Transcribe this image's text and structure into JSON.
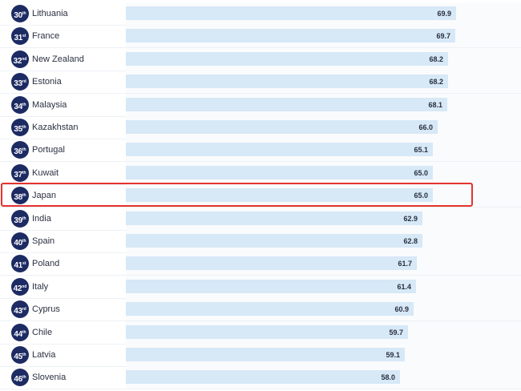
{
  "chart_data": {
    "type": "bar",
    "orientation": "horizontal",
    "title": "",
    "xlabel": "",
    "ylabel": "",
    "xlim": [
      0,
      100
    ],
    "grid": false,
    "legend": "none",
    "rows": [
      {
        "rank": "30",
        "suffix": "th",
        "country": "Lithuania",
        "value": 69.9,
        "label": "69.9"
      },
      {
        "rank": "31",
        "suffix": "st",
        "country": "France",
        "value": 69.7,
        "label": "69.7"
      },
      {
        "rank": "32",
        "suffix": "nd",
        "country": "New Zealand",
        "value": 68.2,
        "label": "68.2"
      },
      {
        "rank": "33",
        "suffix": "rd",
        "country": "Estonia",
        "value": 68.2,
        "label": "68.2"
      },
      {
        "rank": "34",
        "suffix": "th",
        "country": "Malaysia",
        "value": 68.1,
        "label": "68.1"
      },
      {
        "rank": "35",
        "suffix": "th",
        "country": "Kazakhstan",
        "value": 66.0,
        "label": "66.0"
      },
      {
        "rank": "36",
        "suffix": "th",
        "country": "Portugal",
        "value": 65.1,
        "label": "65.1"
      },
      {
        "rank": "37",
        "suffix": "th",
        "country": "Kuwait",
        "value": 65.0,
        "label": "65.0"
      },
      {
        "rank": "38",
        "suffix": "th",
        "country": "Japan",
        "value": 65.0,
        "label": "65.0",
        "highlighted": true
      },
      {
        "rank": "39",
        "suffix": "th",
        "country": "India",
        "value": 62.9,
        "label": "62.9"
      },
      {
        "rank": "40",
        "suffix": "th",
        "country": "Spain",
        "value": 62.8,
        "label": "62.8"
      },
      {
        "rank": "41",
        "suffix": "st",
        "country": "Poland",
        "value": 61.7,
        "label": "61.7"
      },
      {
        "rank": "42",
        "suffix": "nd",
        "country": "Italy",
        "value": 61.4,
        "label": "61.4"
      },
      {
        "rank": "43",
        "suffix": "rd",
        "country": "Cyprus",
        "value": 60.9,
        "label": "60.9"
      },
      {
        "rank": "44",
        "suffix": "th",
        "country": "Chile",
        "value": 59.7,
        "label": "59.7"
      },
      {
        "rank": "45",
        "suffix": "th",
        "country": "Latvia",
        "value": 59.1,
        "label": "59.1"
      },
      {
        "rank": "46",
        "suffix": "th",
        "country": "Slovenia",
        "value": 58.0,
        "label": "58.0"
      }
    ]
  },
  "colors": {
    "badge": "#1d2b63",
    "bar": "#d7e8f6",
    "highlight_border": "#e4332e",
    "text": "#2a3040"
  }
}
